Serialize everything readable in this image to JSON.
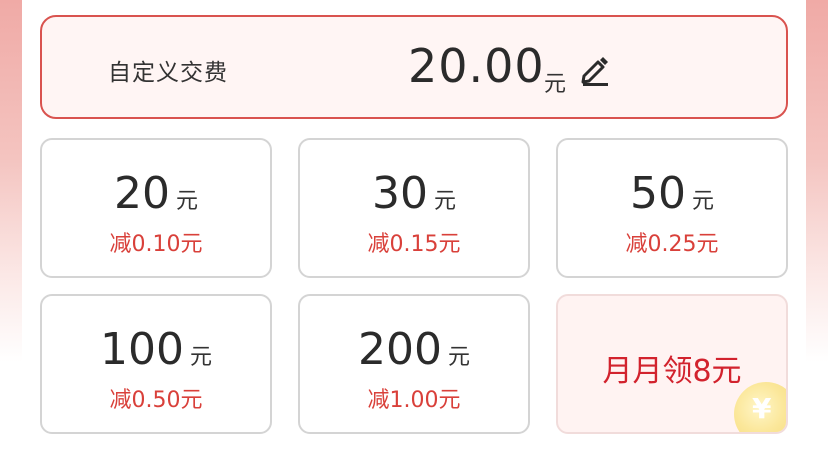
{
  "custom": {
    "label": "自定义交费",
    "amount": "20.00",
    "unit": "元",
    "edit_icon": "pencil-edit-icon"
  },
  "options": [
    {
      "amount": "20",
      "unit": "元",
      "discount": "减0.10元"
    },
    {
      "amount": "30",
      "unit": "元",
      "discount": "减0.15元"
    },
    {
      "amount": "50",
      "unit": "元",
      "discount": "减0.25元"
    },
    {
      "amount": "100",
      "unit": "元",
      "discount": "减0.50元"
    },
    {
      "amount": "200",
      "unit": "元",
      "discount": "减1.00元"
    }
  ],
  "promo": {
    "label": "月月领8元",
    "icon": "yuan-coin-icon"
  },
  "colors": {
    "accent": "#d9534f",
    "discount_text": "#d9403a",
    "promo_text": "#d2222d",
    "custom_bg": "#fff5f4",
    "coin": "#f5d774"
  }
}
